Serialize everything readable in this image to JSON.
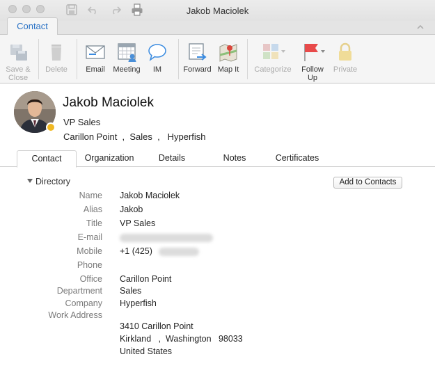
{
  "window": {
    "title": "Jakob Maciolek"
  },
  "ribbon_tab": "Contact",
  "ribbon": {
    "save_close": [
      "Save &",
      "Close"
    ],
    "delete": "Delete",
    "email": "Email",
    "meeting": "Meeting",
    "im": "IM",
    "forward": "Forward",
    "map_it": "Map It",
    "categorize": "Categorize",
    "follow_up": [
      "Follow",
      "Up"
    ],
    "private": "Private"
  },
  "contact": {
    "name": "Jakob Maciolek",
    "title": "VP Sales",
    "office": "Carillon Point",
    "department": "Sales",
    "company": "Hyperfish",
    "presence_color": "#f0b823"
  },
  "tabs": [
    {
      "label": "Contact",
      "active": true
    },
    {
      "label": "Organization"
    },
    {
      "label": "Details"
    },
    {
      "label": "Notes"
    },
    {
      "label": "Certificates"
    }
  ],
  "directory": {
    "section_label": "Directory",
    "add_button": "Add to Contacts",
    "fields": {
      "name": {
        "label": "Name",
        "value": "Jakob Maciolek"
      },
      "alias": {
        "label": "Alias",
        "value": "Jakob"
      },
      "title": {
        "label": "Title",
        "value": "VP Sales"
      },
      "email": {
        "label": "E-mail"
      },
      "mobile": {
        "label": "Mobile",
        "value": "+1 (425)"
      },
      "phone": {
        "label": "Phone"
      },
      "office": {
        "label": "Office",
        "value": "Carillon Point"
      },
      "department": {
        "label": "Department",
        "value": "Sales"
      },
      "company": {
        "label": "Company",
        "value": "Hyperfish"
      },
      "work_address": {
        "label": "Work Address",
        "street": "3410 Carillon Point",
        "city": "Kirkland",
        "state": "Washington",
        "zip": "98033",
        "country": "United States"
      }
    }
  },
  "colors": {
    "accent": "#2a72c5",
    "label_gray": "#7a7a7a"
  }
}
